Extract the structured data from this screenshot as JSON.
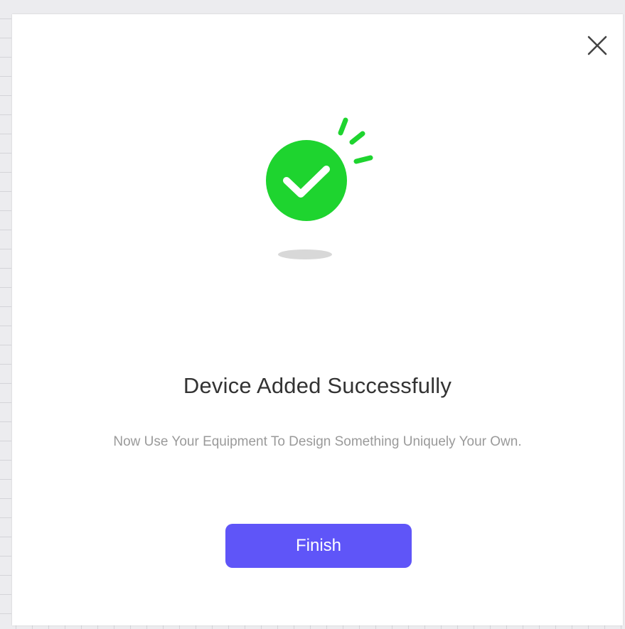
{
  "dialog": {
    "title": "Device Added Successfully",
    "subtitle": "Now Use Your Equipment To Design Something Uniquely Your Own.",
    "finish_label": "Finish",
    "close_icon": "close-icon",
    "success_icon": "checkmark-circle-icon"
  },
  "colors": {
    "accent": "#5f55f8",
    "success": "#1ed42f",
    "title_text": "#333333",
    "subtitle_text": "#9a9a9a"
  }
}
